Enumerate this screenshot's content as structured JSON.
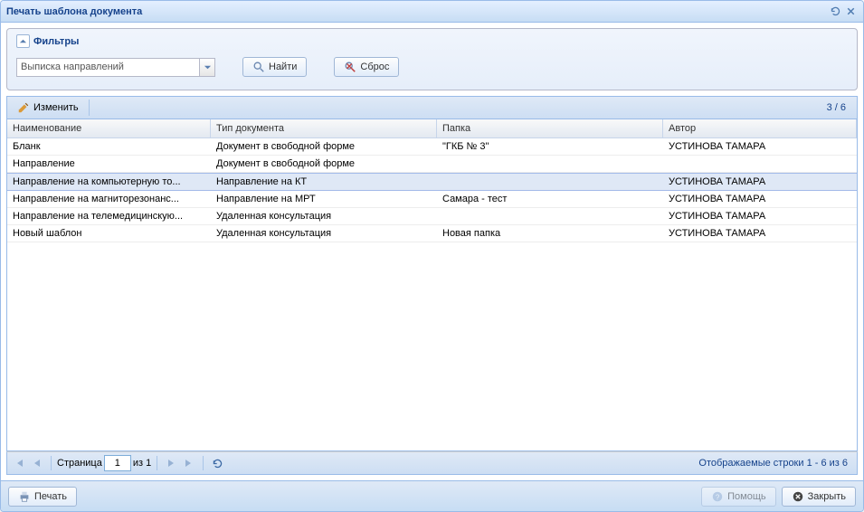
{
  "window": {
    "title": "Печать шаблона документа"
  },
  "filters": {
    "legend": "Фильтры",
    "combo_value": "Выписка направлений",
    "find": "Найти",
    "reset": "Сброс"
  },
  "toolbar": {
    "edit": "Изменить",
    "count": "3 / 6"
  },
  "columns": {
    "name": "Наименование",
    "type": "Тип документа",
    "folder": "Папка",
    "author": "Автор"
  },
  "rows": [
    {
      "name": "Бланк",
      "type": "Документ в свободной форме",
      "folder": "\"ГКБ № 3\"",
      "author": "УСТИНОВА ТАМАРА",
      "selected": false
    },
    {
      "name": "Направление",
      "type": "Документ в свободной форме",
      "folder": "",
      "author": "",
      "selected": false
    },
    {
      "name": "Направление на компьютерную то...",
      "type": "Направление на КТ",
      "folder": "",
      "author": "УСТИНОВА ТАМАРА",
      "selected": true
    },
    {
      "name": "Направление на магниторезонанс...",
      "type": "Направление на МРТ",
      "folder": "Самара - тест",
      "author": "УСТИНОВА ТАМАРА",
      "selected": false
    },
    {
      "name": "Направление на телемедицинскую...",
      "type": "Удаленная консультация",
      "folder": "",
      "author": "УСТИНОВА ТАМАРА",
      "selected": false
    },
    {
      "name": "Новый шаблон",
      "type": "Удаленная консультация",
      "folder": "Новая папка",
      "author": "УСТИНОВА ТАМАРА",
      "selected": false
    }
  ],
  "paging": {
    "page_label": "Страница",
    "page_value": "1",
    "of_label": "из 1",
    "info": "Отображаемые строки 1 - 6 из 6"
  },
  "footer": {
    "print": "Печать",
    "help": "Помощь",
    "close": "Закрыть"
  }
}
